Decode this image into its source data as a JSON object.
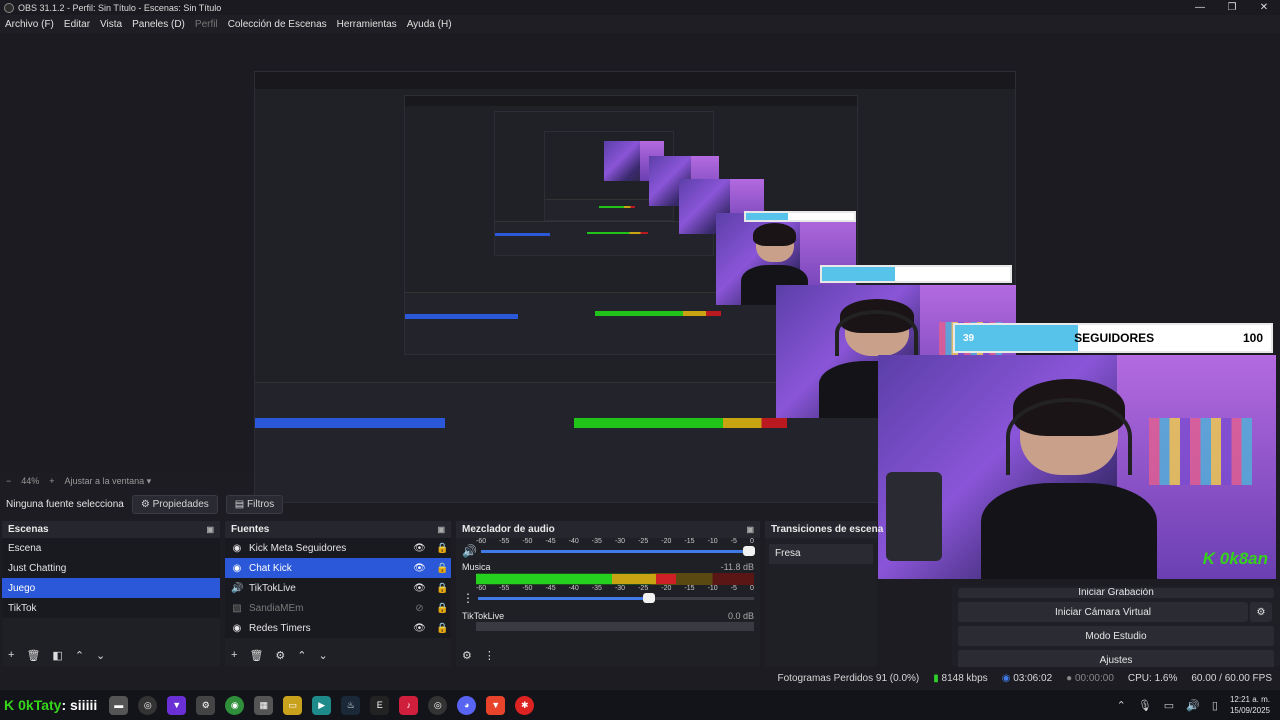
{
  "window": {
    "title": "OBS 31.1.2 - Perfil: Sin Título - Escenas: Sin Título",
    "controls": [
      "—",
      "❐",
      "✕"
    ]
  },
  "menu": [
    {
      "label": "Archivo (F)",
      "enabled": true
    },
    {
      "label": "Editar",
      "enabled": true
    },
    {
      "label": "Vista",
      "enabled": true
    },
    {
      "label": "Paneles (D)",
      "enabled": true
    },
    {
      "label": "Perfil",
      "enabled": false
    },
    {
      "label": "Colección de Escenas",
      "enabled": true
    },
    {
      "label": "Herramientas",
      "enabled": true
    },
    {
      "label": "Ayuda (H)",
      "enabled": true
    }
  ],
  "overlay": {
    "followers_goal": {
      "current": "39",
      "label": "SEGUIDORES",
      "target": "100",
      "progress": 0.39
    },
    "logo": "0k8an"
  },
  "zoom": {
    "minus": "−",
    "value": "44%",
    "plus": "+",
    "fit": "Ajustar a la ventana"
  },
  "source_bar": {
    "no_source": "Ninguna fuente selecciona",
    "properties": "Propiedades",
    "filters": "Filtros"
  },
  "scenes": {
    "title": "Escenas",
    "items": [
      {
        "label": "Escena",
        "selected": false
      },
      {
        "label": "Just Chatting",
        "selected": false
      },
      {
        "label": "Juego",
        "selected": true
      },
      {
        "label": "TikTok",
        "selected": false
      }
    ]
  },
  "sources": {
    "title": "Fuentes",
    "items": [
      {
        "label": "Kick Meta Seguidores",
        "icon": "browser-icon",
        "visible": true,
        "locked": true,
        "selected": false
      },
      {
        "label": "Chat Kick",
        "icon": "browser-icon",
        "visible": true,
        "locked": true,
        "selected": true
      },
      {
        "label": "TikTokLive",
        "icon": "audio-icon",
        "visible": true,
        "locked": true,
        "selected": false
      },
      {
        "label": "SandiaMEm",
        "icon": "image-icon",
        "visible": false,
        "locked": true,
        "selected": false
      },
      {
        "label": "Redes Timers",
        "icon": "browser-icon",
        "visible": true,
        "locked": true,
        "selected": false
      }
    ]
  },
  "mixer": {
    "title": "Mezclador de audio",
    "ticks": [
      "-60",
      "-55",
      "-50",
      "-45",
      "-40",
      "-35",
      "-30",
      "-25",
      "-20",
      "-15",
      "-10",
      "-5",
      "0"
    ],
    "tracks": [
      {
        "name": "",
        "db": "",
        "level": 0.0,
        "volume": 1.0
      },
      {
        "name": "Musica",
        "db": "-11.8 dB",
        "level": 0.72,
        "volume": 0.62
      },
      {
        "name": "TikTokLive",
        "db": "0.0 dB",
        "level": 0.0,
        "volume": 1.0
      }
    ]
  },
  "transitions": {
    "title": "Transiciones de escena",
    "current": "Fresa"
  },
  "controls": {
    "start_recording": "Iniciar Grabación",
    "virtual_camera": "Iniciar Cámara Virtual",
    "studio_mode": "Modo Estudio",
    "settings": "Ajustes"
  },
  "status": {
    "dropped_frames": "Fotogramas Perdidos 91 (0.0%)",
    "bitrate": "8148 kbps",
    "stream_time": "03:06:02",
    "rec_time": "00:00:00",
    "cpu": "CPU: 1.6%",
    "fps": "60.00 / 60.00 FPS"
  },
  "taskbar": {
    "kick_logo": "K",
    "username": "0kTaty",
    "message": ": siiiii",
    "time": "12:21 a. m.",
    "date": "15/09/2025"
  },
  "colors": {
    "accent": "#2a58d8",
    "kick_green": "#35d61a",
    "follow_bar": "#58c3ea"
  }
}
